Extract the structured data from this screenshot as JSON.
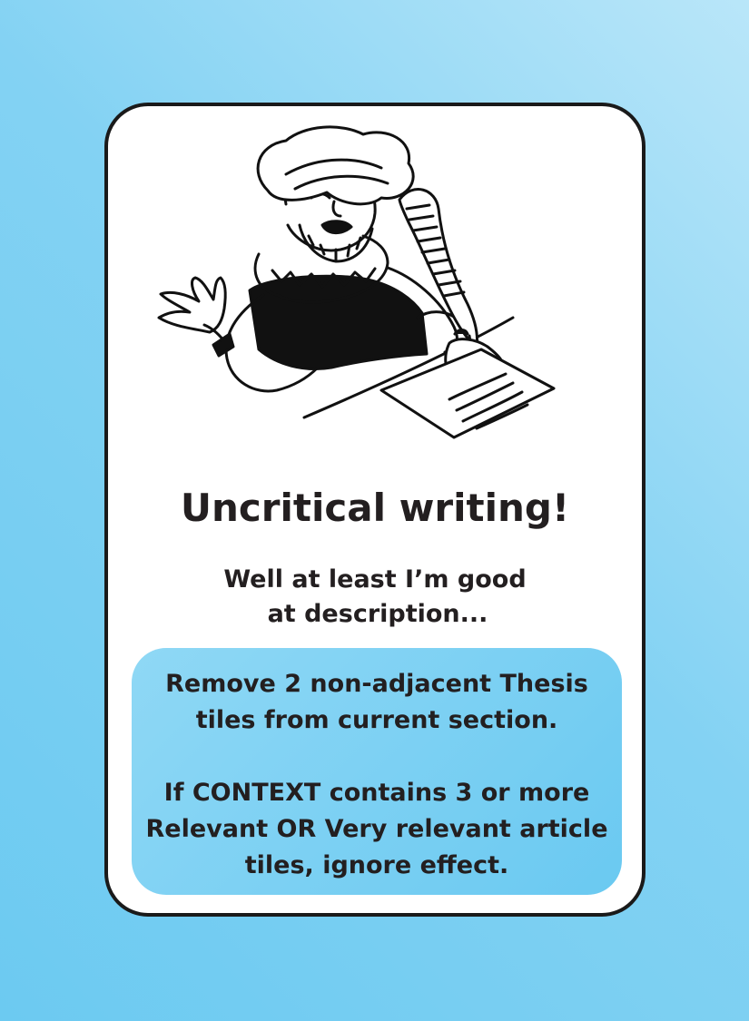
{
  "card": {
    "background_color": "#6ccaf1",
    "accent_color": "#8fd8f5",
    "illustration_icon": "scholar-writing-with-quill-icon",
    "title": "Uncritical writing!",
    "flavor_lines": [
      "Well at least I’m good",
      "at description..."
    ],
    "effect_paragraph_1": [
      "Remove 2 non-adjacent Thesis",
      "tiles from current section."
    ],
    "effect_paragraph_2": [
      "If CONTEXT contains 3 or more",
      "Relevant OR Very relevant article",
      "tiles, ignore effect."
    ]
  }
}
